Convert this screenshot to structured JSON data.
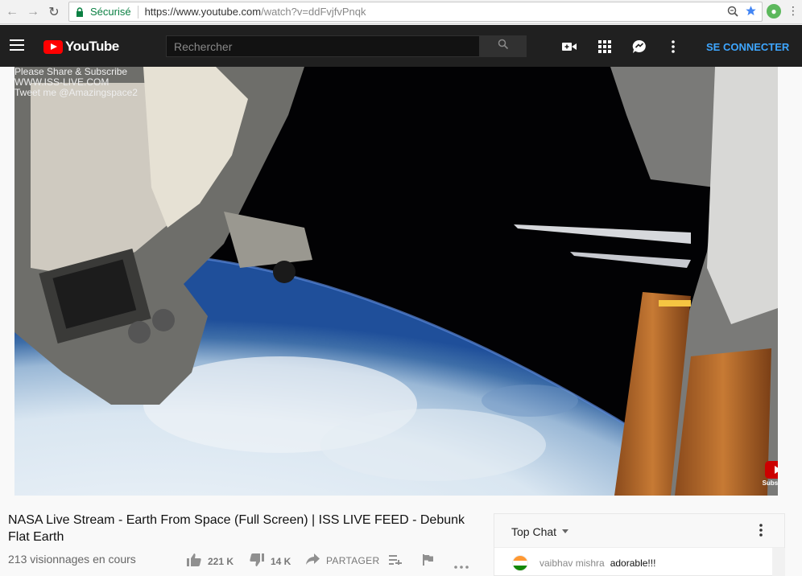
{
  "browser": {
    "secure_label": "Sécurisé",
    "url_host": "https://www.youtube.com",
    "url_path": "/watch?v=ddFvjfvPnqk"
  },
  "header": {
    "logo_text": "YouTube",
    "search_placeholder": "Rechercher",
    "signin_label": "SE CONNECTER"
  },
  "video": {
    "overlay_lines": [
      "Please Share & Subscribe",
      "WWW.ISS-LIVE.COM",
      "Tweet me @Amazingspace2"
    ],
    "subscribe_label": "Subscribe"
  },
  "info": {
    "title": "NASA Live Stream - Earth From Space (Full Screen) | ISS LIVE FEED - Debunk Flat Earth",
    "views": "213 visionnages en cours",
    "likes": "221 K",
    "dislikes": "14 K",
    "share_label": "PARTAGER"
  },
  "chat": {
    "title": "Top Chat",
    "messages": [
      {
        "author": "vaibhav mishra",
        "text": "adorable!!!"
      }
    ]
  }
}
